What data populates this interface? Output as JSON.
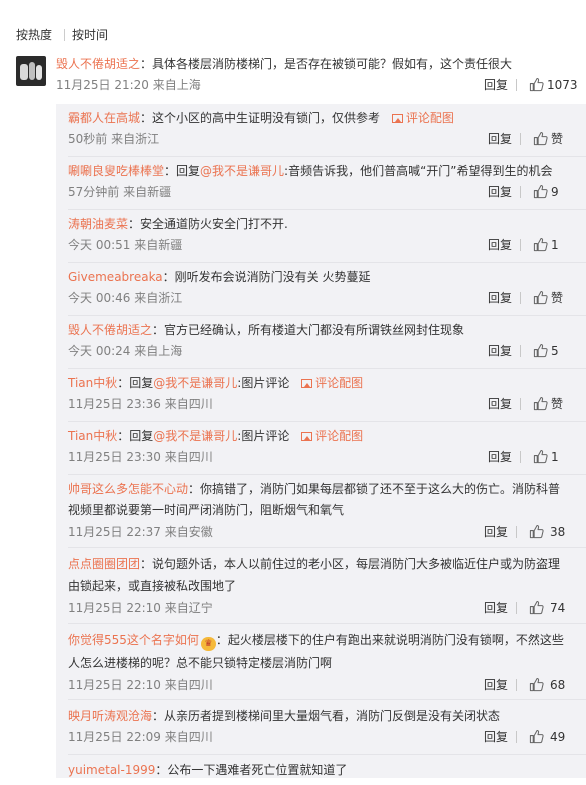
{
  "sort_bar": {
    "hot": "按热度",
    "time": "按时间"
  },
  "main_comment": {
    "user": "毁人不倦胡适之",
    "text": "：具体各楼层消防楼梯门，是否存在被锁可能？假如有，这个责任很大",
    "time": "11月25日 21:20 来自上海",
    "reply_label": "回复",
    "likes": "1073"
  },
  "replies": [
    {
      "user": "霸都人在高城",
      "text": "：这个小区的高中生证明没有锁门，仅供参考",
      "pic": "评论配图",
      "time": "50秒前 来自浙江",
      "reply_label": "回复",
      "likes": "赞"
    },
    {
      "user": "唰唰良叟吃棒棒堂",
      "text_a": "：回复",
      "at": "@我不是谦哥儿",
      "text_b": ":音频告诉我，他们普高喊“开门”希望得到生的机会",
      "time": "57分钟前 来自新疆",
      "reply_label": "回复",
      "likes": "9"
    },
    {
      "user": "涛朝油麦菜",
      "text": "：安全通道防火安全门打不开.",
      "time": "今天 00:51 来自新疆",
      "reply_label": "回复",
      "likes": "1"
    },
    {
      "user": "Givemeabreaka",
      "text": "：刚听发布会说消防门没有关 火势蔓延",
      "time": "今天 00:46 来自浙江",
      "reply_label": "回复",
      "likes": "赞"
    },
    {
      "user": "毁人不倦胡适之",
      "text": "：官方已经确认，所有楼道大门都没有所谓铁丝网封住现象",
      "time": "今天 00:24 来自上海",
      "reply_label": "回复",
      "likes": "5"
    },
    {
      "user": "Tian中秋",
      "text_a": "：回复",
      "at": "@我不是谦哥儿",
      "text_b": ":图片评论",
      "pic": "评论配图",
      "time": "11月25日 23:36 来自四川",
      "reply_label": "回复",
      "likes": "赞"
    },
    {
      "user": "Tian中秋",
      "text_a": "：回复",
      "at": "@我不是谦哥儿",
      "text_b": ":图片评论",
      "pic": "评论配图",
      "time": "11月25日 23:30 来自四川",
      "reply_label": "回复",
      "likes": "1"
    },
    {
      "user": "帅哥这么多怎能不心动",
      "text": "：你搞错了，消防门如果每层都锁了还不至于这么大的伤亡。消防科普",
      "text2": "视频里都说要第一时间严闭消防门，阻断烟气和氧气",
      "time": "11月25日 22:37 来自安徽",
      "reply_label": "回复",
      "likes": "38"
    },
    {
      "user": "点点圈圈团团",
      "text": "：说句题外话，本人以前住过的老小区，每层消防门大多被临近住户或为防盗理",
      "text2": "由锁起来，或直接被私改围地了",
      "time": "11月25日 22:10 来自辽宁",
      "reply_label": "回复",
      "likes": "74"
    },
    {
      "user": "你觉得555这个名字如何",
      "text": "：起火楼层楼下的住户有跑出来就说明消防门没有锁啊，不然这些",
      "text2": "人怎么进楼梯的呢？总不能只锁特定楼层消防门啊",
      "time": "11月25日 22:10 来自四川",
      "reply_label": "回复",
      "likes": "68"
    },
    {
      "user": "映月听涛观沧海",
      "text": "：从亲历者提到楼梯间里大量烟气看，消防门反倒是没有关闭状态",
      "time": "11月25日 22:09 来自四川",
      "reply_label": "回复",
      "likes": "49"
    },
    {
      "user": "yuimetal-1999",
      "text": "：公布一下遇难者死亡位置就知道了"
    }
  ],
  "icons": {
    "thumb": "thumbs-up-icon",
    "picture": "picture-icon",
    "emoji": "emoji-badge-icon"
  },
  "colors": {
    "username": "#eb7350",
    "reply_bg": "#f2f2f5",
    "text": "#333333"
  }
}
